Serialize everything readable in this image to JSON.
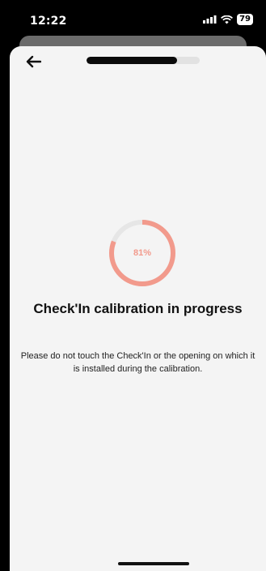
{
  "status_bar": {
    "time": "12:22",
    "battery": "79"
  },
  "header": {
    "step_progress": 0.8
  },
  "calibration": {
    "percent": 0.81,
    "percent_label": "81%",
    "title": "Check'In calibration in progress",
    "description": "Please do not touch the Check'In or the opening on which it is installed during the calibration."
  },
  "colors": {
    "accent": "#f29a8c",
    "ring_track": "#e6e6e6",
    "sheet_bg": "#f4f4f4",
    "progress_fill": "#0b0b0b"
  },
  "icons": {
    "back": "arrow-left-icon",
    "signal": "signal-icon",
    "wifi": "wifi-icon",
    "battery": "battery-icon"
  }
}
